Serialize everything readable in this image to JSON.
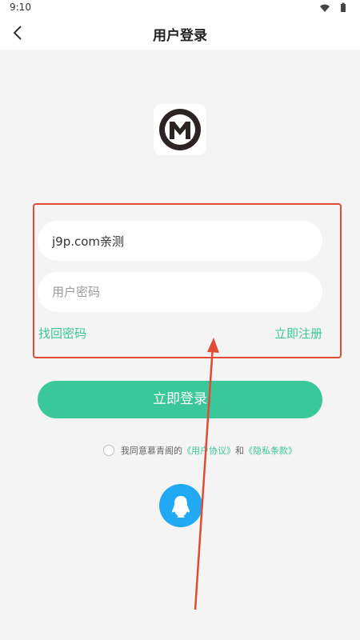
{
  "status_bar": {
    "time": "9:10",
    "wifi_icon": "wifi-icon",
    "battery_icon": "battery-icon"
  },
  "app_bar": {
    "back_icon": "chevron-left-icon",
    "title": "用户登录"
  },
  "logo": {
    "icon": "m-logo-icon"
  },
  "form": {
    "username_value": "j9p.com亲测",
    "password_placeholder": "用户密码",
    "forgot_label": "找回密码",
    "register_label": "立即注册"
  },
  "login_button": {
    "label": "立即登录"
  },
  "agreement": {
    "prefix": "我同意慕青阁的",
    "user_agreement": "《用户协议》",
    "and": "和",
    "privacy_policy": "《隐私条款》"
  },
  "social": {
    "qq_icon": "qq-icon"
  },
  "colors": {
    "accent": "#3ac89a",
    "annotation": "#e04b34",
    "qq": "#22a9f3"
  }
}
